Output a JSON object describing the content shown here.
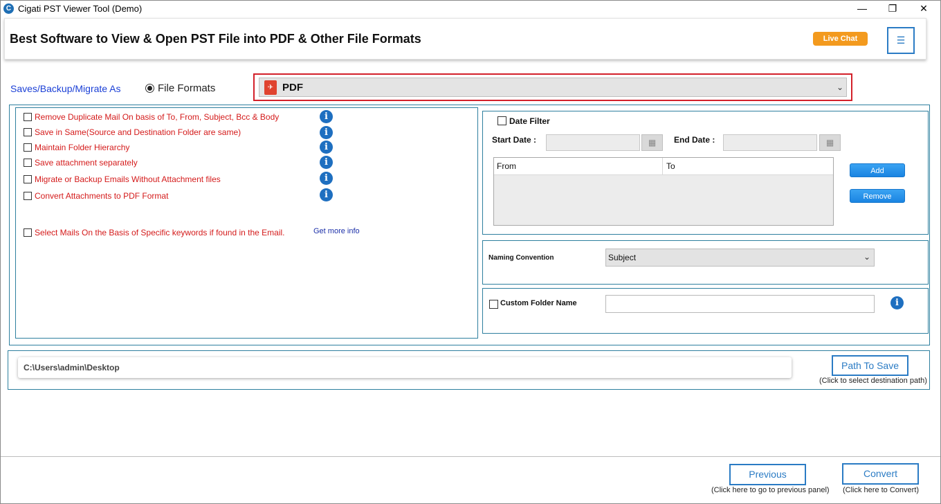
{
  "window": {
    "title": "Cigati PST Viewer Tool (Demo)",
    "icon_letter": "C",
    "minimize_glyph": "—",
    "maximize_glyph": "❐",
    "close_glyph": "✕"
  },
  "header": {
    "title": "Best Software to View & Open PST File into PDF & Other File Formats",
    "live_chat_label": "Live Chat",
    "menu_glyph": "☰"
  },
  "save_as": {
    "label": "Saves/Backup/Migrate As",
    "radio_label": "File Formats",
    "selected_format": "PDF",
    "pdf_icon_glyph": "✈"
  },
  "options": {
    "items": [
      {
        "label": "Remove Duplicate Mail On basis of To, From, Subject, Bcc & Body",
        "checked": false
      },
      {
        "label": "Save in Same(Source and Destination Folder are same)",
        "checked": false
      },
      {
        "label": "Maintain Folder Hierarchy",
        "checked": false
      },
      {
        "label": "Save attachment separately",
        "checked": false
      },
      {
        "label": "Migrate or Backup Emails Without Attachment files",
        "checked": false
      },
      {
        "label": "Convert Attachments to PDF Format",
        "checked": false
      }
    ],
    "keyword_label": "Select Mails On the Basis of Specific keywords if found in the Email.",
    "get_more_info": "Get more info",
    "info_glyph": "i"
  },
  "date_filter": {
    "label": "Date Filter",
    "start_label": "Start Date :",
    "end_label": "End Date :",
    "start_value": "",
    "end_value": "",
    "calendar_glyph": "▦",
    "table_headers": [
      "From",
      "To"
    ],
    "add_label": "Add",
    "remove_label": "Remove"
  },
  "naming": {
    "label": "Naming Convention",
    "value": "Subject"
  },
  "custom_folder": {
    "label": "Custom Folder Name",
    "value": ""
  },
  "path": {
    "value": "C:\\Users\\admin\\Desktop",
    "button_label": "Path To Save",
    "hint": "(Click to select destination path)"
  },
  "footer": {
    "previous_label": "Previous",
    "previous_hint": "(Click here to go to previous panel)",
    "convert_label": "Convert",
    "convert_hint": "(Click here to Convert)"
  },
  "colors": {
    "accent_blue": "#2a7bc4",
    "option_red": "#d41a1a",
    "live_chat_orange": "#f39a1e",
    "format_border_red": "#d3202a"
  }
}
